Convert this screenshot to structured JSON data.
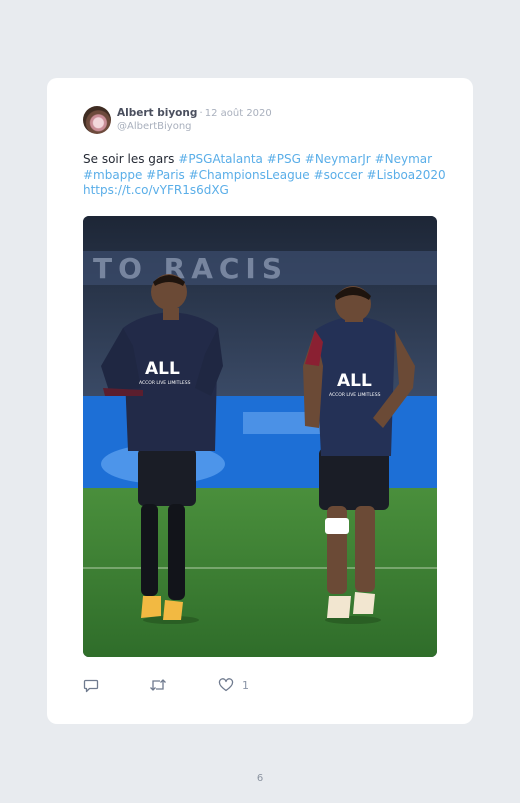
{
  "tweet": {
    "author_name": "Albert biyong",
    "separator": "·",
    "date": "12 août 2020",
    "handle": "@AlbertBiyong",
    "text_plain": "Se soir les gars",
    "hashtags": [
      "#PSGAtalanta",
      "#PSG",
      "#NeymarJr",
      "#Neymar",
      "#mbappe",
      "#Paris",
      "#ChampionsLeague",
      "#soccer",
      "#Lisboa2020"
    ],
    "link": "https://t.co/vYFR1s6dXG",
    "like_count": "1"
  },
  "photo": {
    "banner_text": "TO RACIS",
    "shirt_sponsor": "ALL",
    "shirt_sponsor_sub": "ACCOR LIVE LIMITLESS"
  },
  "icons": {
    "reply": "reply-icon",
    "retweet": "retweet-icon",
    "like": "heart-icon"
  },
  "colors": {
    "hashtag": "#5aaee8",
    "background": "#e8ebef"
  },
  "footer": {
    "page_number": "6"
  }
}
